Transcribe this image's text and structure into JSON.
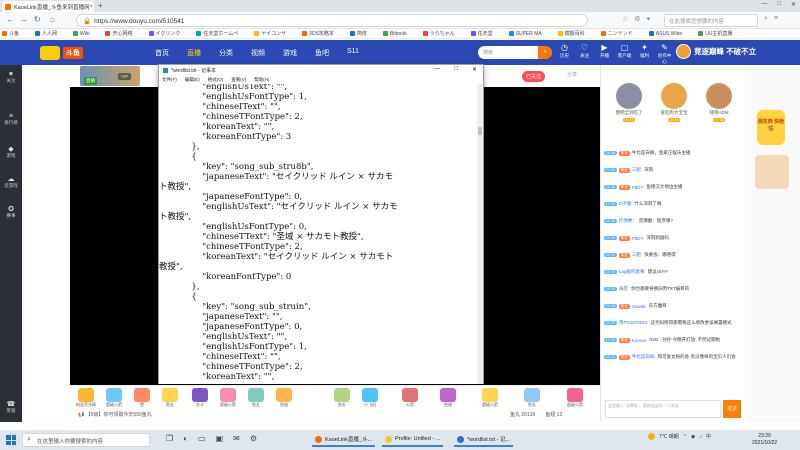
{
  "browser": {
    "tab_title": "KaoeLink直播_斗鱼来到直播网",
    "url": "https://www.douyu.com/510541",
    "search_placeholder": "在此搜索您想要的内容",
    "bookmarks": [
      "斗鱼",
      "人人网",
      "Wiki",
      "开心网络",
      "イクリンク",
      "任天堂ホームペ",
      "ヤイコンサ",
      "3DS攻略本",
      "简体",
      "Bitbook",
      "うらちゃん",
      "任天堂",
      "SUPER MA",
      "模擬百科",
      "ニンテンド",
      "ASUS Wibe",
      "UU主机直播"
    ]
  },
  "site": {
    "logo_text": "斗鱼",
    "nav": [
      "首页",
      "直播",
      "分类",
      "视频",
      "游戏",
      "鱼吧",
      "S11"
    ],
    "search_placeholder": "搜索",
    "header_icons": [
      "历史",
      "关注",
      "开播",
      "客户端",
      "福利",
      "创作中心"
    ],
    "promo_text": "竟逐巅峰 不破不立"
  },
  "left_sidebar": [
    "关注",
    "排行榜",
    "游戏",
    "云游戏",
    "赛事",
    "客服"
  ],
  "room": {
    "live_badge": "直播",
    "vip_label": "VIP",
    "follow_pill": "已关注",
    "share_label": "分享"
  },
  "notepad": {
    "title": "*wordlist.txt - 记事本",
    "menu": [
      "文件(F)",
      "编辑(E)",
      "格式(O)",
      "查看(V)",
      "帮助(H)"
    ],
    "lines": [
      "                \"englishUsText\": \"\",",
      "                \"englishUsFontType\": 1,",
      "                \"chineseIText\": \"\",",
      "                \"chineseTFontType\": 2,",
      "                \"koreanText\": \"\",",
      "                \"koreanFontType\": 3",
      "            },",
      "            {",
      "                \"key\": \"song_sub_stru8b\",",
      "                \"japaneseText\": \"セイクリッド ルイン × サカモ",
      "ト教授\",",
      "                \"japaneseFontType\": 0,",
      "                \"englishUsText\": \"セイクリッド ルイン × サカモ",
      "ト教授\",",
      "                \"englishUsFontType\": 0,",
      "                \"chineseTText\": \"圣域 × サカモト教授\",",
      "                \"chineseTFontType\": 2,",
      "                \"koreanText\": \"セイクリッド ルイン × サカモト",
      "教授\",",
      "                \"koreanFontType\": 0",
      "            },",
      "            {",
      "                \"key\": \"song_sub_struin\",",
      "                \"japaneseText\": \"\",",
      "                \"japaneseFontType\": 0,",
      "                \"englishUsText\": \"\",",
      "                \"englishUsFontType\": 1,",
      "                \"chineseIText\": \"\",",
      "                \"chineseTFontType\": 2,",
      "                \"koreanText\": \"\","
    ]
  },
  "gifts": [
    "粉丝荧光棒",
    "超级火箭",
    "赞",
    "鱼丸",
    "办卡",
    "超级火箭",
    "鱼丸",
    "鱼翅",
    "鱼丸",
    "小飞机",
    "火箭",
    "鱼翅",
    "超级火箭",
    "鱼丸",
    "超级火箭"
  ],
  "room_message": "【5级】你可领取今天550鱼丸",
  "room_stats": [
    "鱼丸 20139",
    "鱼翅 12"
  ],
  "rank": [
    {
      "name": "我把全洞吃了",
      "level": "LV 43",
      "color": "#8a8fa3"
    },
    {
      "name": "爱吃枸大宝宝",
      "level": "LV 43",
      "color": "#e8a64a"
    },
    {
      "name": "钱钱ADM",
      "level": "LV 36",
      "color": "#c9905d"
    }
  ],
  "chat": [
    {
      "lv": "LV 36",
      "fan": "粉丝",
      "user": "",
      "text": "牛比是白痴，鱼家正娱乐主播"
    },
    {
      "lv": "LV 31",
      "fan": "粉丝",
      "user": "三肥:",
      "text": "深刻"
    },
    {
      "lv": "LV 40",
      "fan": "粉丝",
      "user": "F8DY:",
      "text": "鱼德汉大地边主播"
    },
    {
      "lv": "LV 31",
      "fan": "",
      "user": "D子瘤:",
      "text": "什么深刻了啊"
    },
    {
      "lv": "LV 30",
      "fan": "",
      "user": "炸弹梗：",
      "text": "走哪翻：程序课?"
    },
    {
      "lv": "LV 31",
      "fan": "粉丝",
      "user": "F8DY:",
      "text": "深刻则副码"
    },
    {
      "lv": "LV 22",
      "fan": "粉丝",
      "user": "三肥:",
      "text": "快要会、哪德得"
    },
    {
      "lv": "LV 37",
      "fan": "",
      "user": "Lag服的歌事:",
      "text": "建议ctrl+F"
    },
    {
      "lv": "LV 12",
      "fan": "",
      "user": "海底:",
      "text": "你岂都要将换旧用TXT编目的"
    },
    {
      "lv": "LV 28",
      "fan": "粉丝",
      "user": "Suwak:",
      "text": "东方魔目"
    },
    {
      "lv": "LV 37",
      "fan": "",
      "user": "用PO1870054:",
      "text": "这代码所得那需要这么修改更该搁置模式"
    },
    {
      "lv": "LV 31",
      "fan": "粉丝",
      "user": "Kumsa:",
      "text": "OvO : 孙孙·今晚开灯放: 不然过期啦"
    },
    {
      "lv": "LV 21",
      "fan": "粉丝",
      "user": "牛比是白痴:",
      "text": "和可爱女粉的会·有没像样的宝贝人们会"
    }
  ],
  "chat_input_placeholder": "这里输入\"卡牌啦\"，更新会这样一下发送",
  "send_label": "发送",
  "ad_text": "领东西 快抢住",
  "taskbar": {
    "search_placeholder": "在这里输入你要搜索的内容",
    "apps": [
      "KaoeLink直播_斗...",
      "Profile: Unified - ...",
      "*wordlist.txt - 记..."
    ],
    "weather": "7℃ 晴朗",
    "time": "23:29",
    "date": "2021/10/22"
  }
}
